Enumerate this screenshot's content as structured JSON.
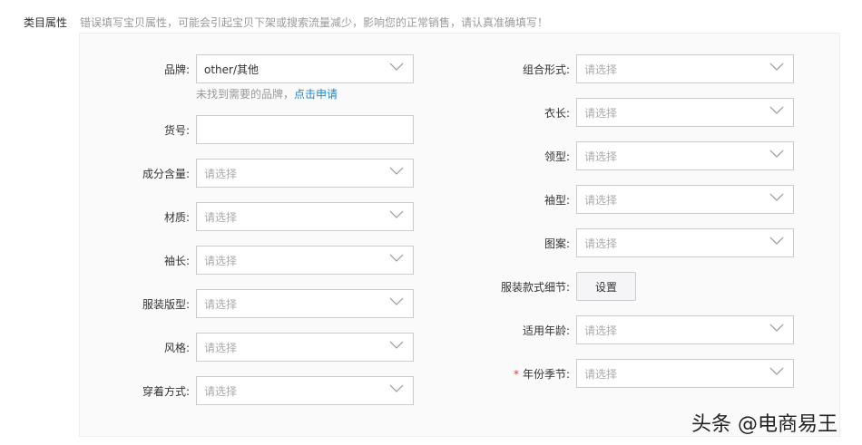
{
  "section": {
    "label": "类目属性",
    "hint": "错误填写宝贝属性，可能会引起宝贝下架或搜索流量减少，影响您的正常销售，请认真准确填写！"
  },
  "brand": {
    "label": "品牌:",
    "value": "other/其他",
    "not_found": "未找到需要的品牌，",
    "apply_link": "点击申请"
  },
  "item_no": {
    "label": "货号:",
    "value": ""
  },
  "left_fields": [
    {
      "label": "成分含量:",
      "placeholder": "请选择"
    },
    {
      "label": "材质:",
      "placeholder": "请选择"
    },
    {
      "label": "袖长:",
      "placeholder": "请选择"
    },
    {
      "label": "服装版型:",
      "placeholder": "请选择"
    },
    {
      "label": "风格:",
      "placeholder": "请选择"
    },
    {
      "label": "穿着方式:",
      "placeholder": "请选择"
    }
  ],
  "right_fields": [
    {
      "label": "组合形式:",
      "placeholder": "请选择"
    },
    {
      "label": "衣长:",
      "placeholder": "请选择"
    },
    {
      "label": "领型:",
      "placeholder": "请选择"
    },
    {
      "label": "袖型:",
      "placeholder": "请选择"
    },
    {
      "label": "图案:",
      "placeholder": "请选择"
    }
  ],
  "style_detail": {
    "label": "服装款式细节:",
    "button": "设置"
  },
  "age": {
    "label": "适用年龄:",
    "placeholder": "请选择"
  },
  "season": {
    "required": "*",
    "label": "年份季节:",
    "placeholder": "请选择"
  },
  "watermark": "头条 @电商易王"
}
